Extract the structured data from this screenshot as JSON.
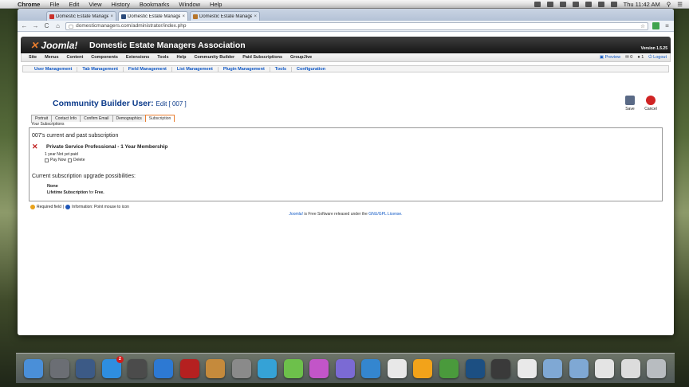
{
  "menubar": {
    "app": "Chrome",
    "items": [
      "File",
      "Edit",
      "View",
      "History",
      "Bookmarks",
      "Window",
      "Help"
    ],
    "clock": "Thu 11:42 AM"
  },
  "browser": {
    "tabs": [
      {
        "title": "Domestic Estate Managers",
        "favicon_color": "#c9312b",
        "active": false
      },
      {
        "title": "Domestic Estate Managers A",
        "favicon_color": "#2b4a7a",
        "active": true
      },
      {
        "title": "Domestic Estate Managers A",
        "favicon_color": "#b7752a",
        "active": false
      }
    ],
    "url": "domesticmanagers.com/administrator/index.php"
  },
  "joomla": {
    "logo": "Joomla!",
    "site_name": "Domestic Estate Managers Association",
    "version": "Version 1.5.25",
    "menu": [
      "Site",
      "Menus",
      "Content",
      "Components",
      "Extensions",
      "Tools",
      "Help",
      "Community Builder",
      "Paid Subscriptions",
      "GroupJive"
    ],
    "status": {
      "preview": "Preview",
      "messages": "0",
      "users": "1",
      "logout": "Logout"
    },
    "submenu": [
      "User Management",
      "Tab Management",
      "Field Management",
      "List Management",
      "Plugin Management",
      "Tools",
      "Configuration"
    ]
  },
  "page": {
    "title": "Community Builder User:",
    "subtitle": "Edit [ 007 ]",
    "save_label": "Save",
    "cancel_label": "Cancel"
  },
  "cb_tabs": [
    "Portrait",
    "Contact Info",
    "Confirm Email",
    "Demographics",
    "Subscription"
  ],
  "subscriptions": {
    "label": "Your Subscriptions",
    "current_heading": "007's current and past subscription",
    "plan_name": "Private Service Professional - 1 Year Membership",
    "plan_status": "1 year Not yet paid",
    "pay_now": "Pay Now",
    "delete": "Delete",
    "upgrade_heading": "Current subscription upgrade possibilities:",
    "upgrade_none": "None",
    "upgrade_lifetime_label": "Lifetime Subscription",
    "upgrade_lifetime_for": "for",
    "upgrade_lifetime_price": "Free."
  },
  "legend": {
    "required": "Required field",
    "information": "Information: Point mouse to icon"
  },
  "footer": {
    "joomla_link": "Joomla!",
    "text": "is Free Software released under the",
    "license_link": "GNU/GPL License."
  },
  "dock": {
    "icons": [
      {
        "name": "finder-icon",
        "color": "#4a8fd8"
      },
      {
        "name": "launchpad-icon",
        "color": "#6b6e74"
      },
      {
        "name": "dashboard-icon",
        "color": "#3c5a86"
      },
      {
        "name": "app-store-icon",
        "color": "#2e8ee0",
        "badge": "2"
      },
      {
        "name": "facetime-icon",
        "color": "#4b4b4b"
      },
      {
        "name": "itunes-icon",
        "color": "#2d79d3"
      },
      {
        "name": "photo-booth-icon",
        "color": "#b52020"
      },
      {
        "name": "preview-icon",
        "color": "#c58a3c"
      },
      {
        "name": "system-preferences-icon",
        "color": "#8a8a8a"
      },
      {
        "name": "app-w-icon",
        "color": "#35a2d6"
      },
      {
        "name": "app-h-icon",
        "color": "#6dc04b"
      },
      {
        "name": "app-p-icon",
        "color": "#c255c8"
      },
      {
        "name": "app-e-icon",
        "color": "#7b6ad4"
      },
      {
        "name": "contacts-icon",
        "color": "#3486cf"
      },
      {
        "name": "calculator-icon",
        "color": "#e8e8e8"
      },
      {
        "name": "flower-app-icon",
        "color": "#f2a31a"
      },
      {
        "name": "chrome-icon",
        "color": "#4a9a3c"
      },
      {
        "name": "photoshop-icon",
        "color": "#1c4f82"
      },
      {
        "name": "terminal-icon",
        "color": "#3a3a3a"
      },
      {
        "name": "acrobat-icon",
        "color": "#e9e9e9"
      },
      {
        "name": "folder-icon",
        "color": "#7fa8d4"
      },
      {
        "name": "folder-2-icon",
        "color": "#7fa8d4"
      },
      {
        "name": "document-stack-icon",
        "color": "#e4e4e4"
      },
      {
        "name": "document-stack-2-icon",
        "color": "#dcdcdc"
      },
      {
        "name": "trash-icon",
        "color": "#b8bcc0"
      }
    ]
  }
}
